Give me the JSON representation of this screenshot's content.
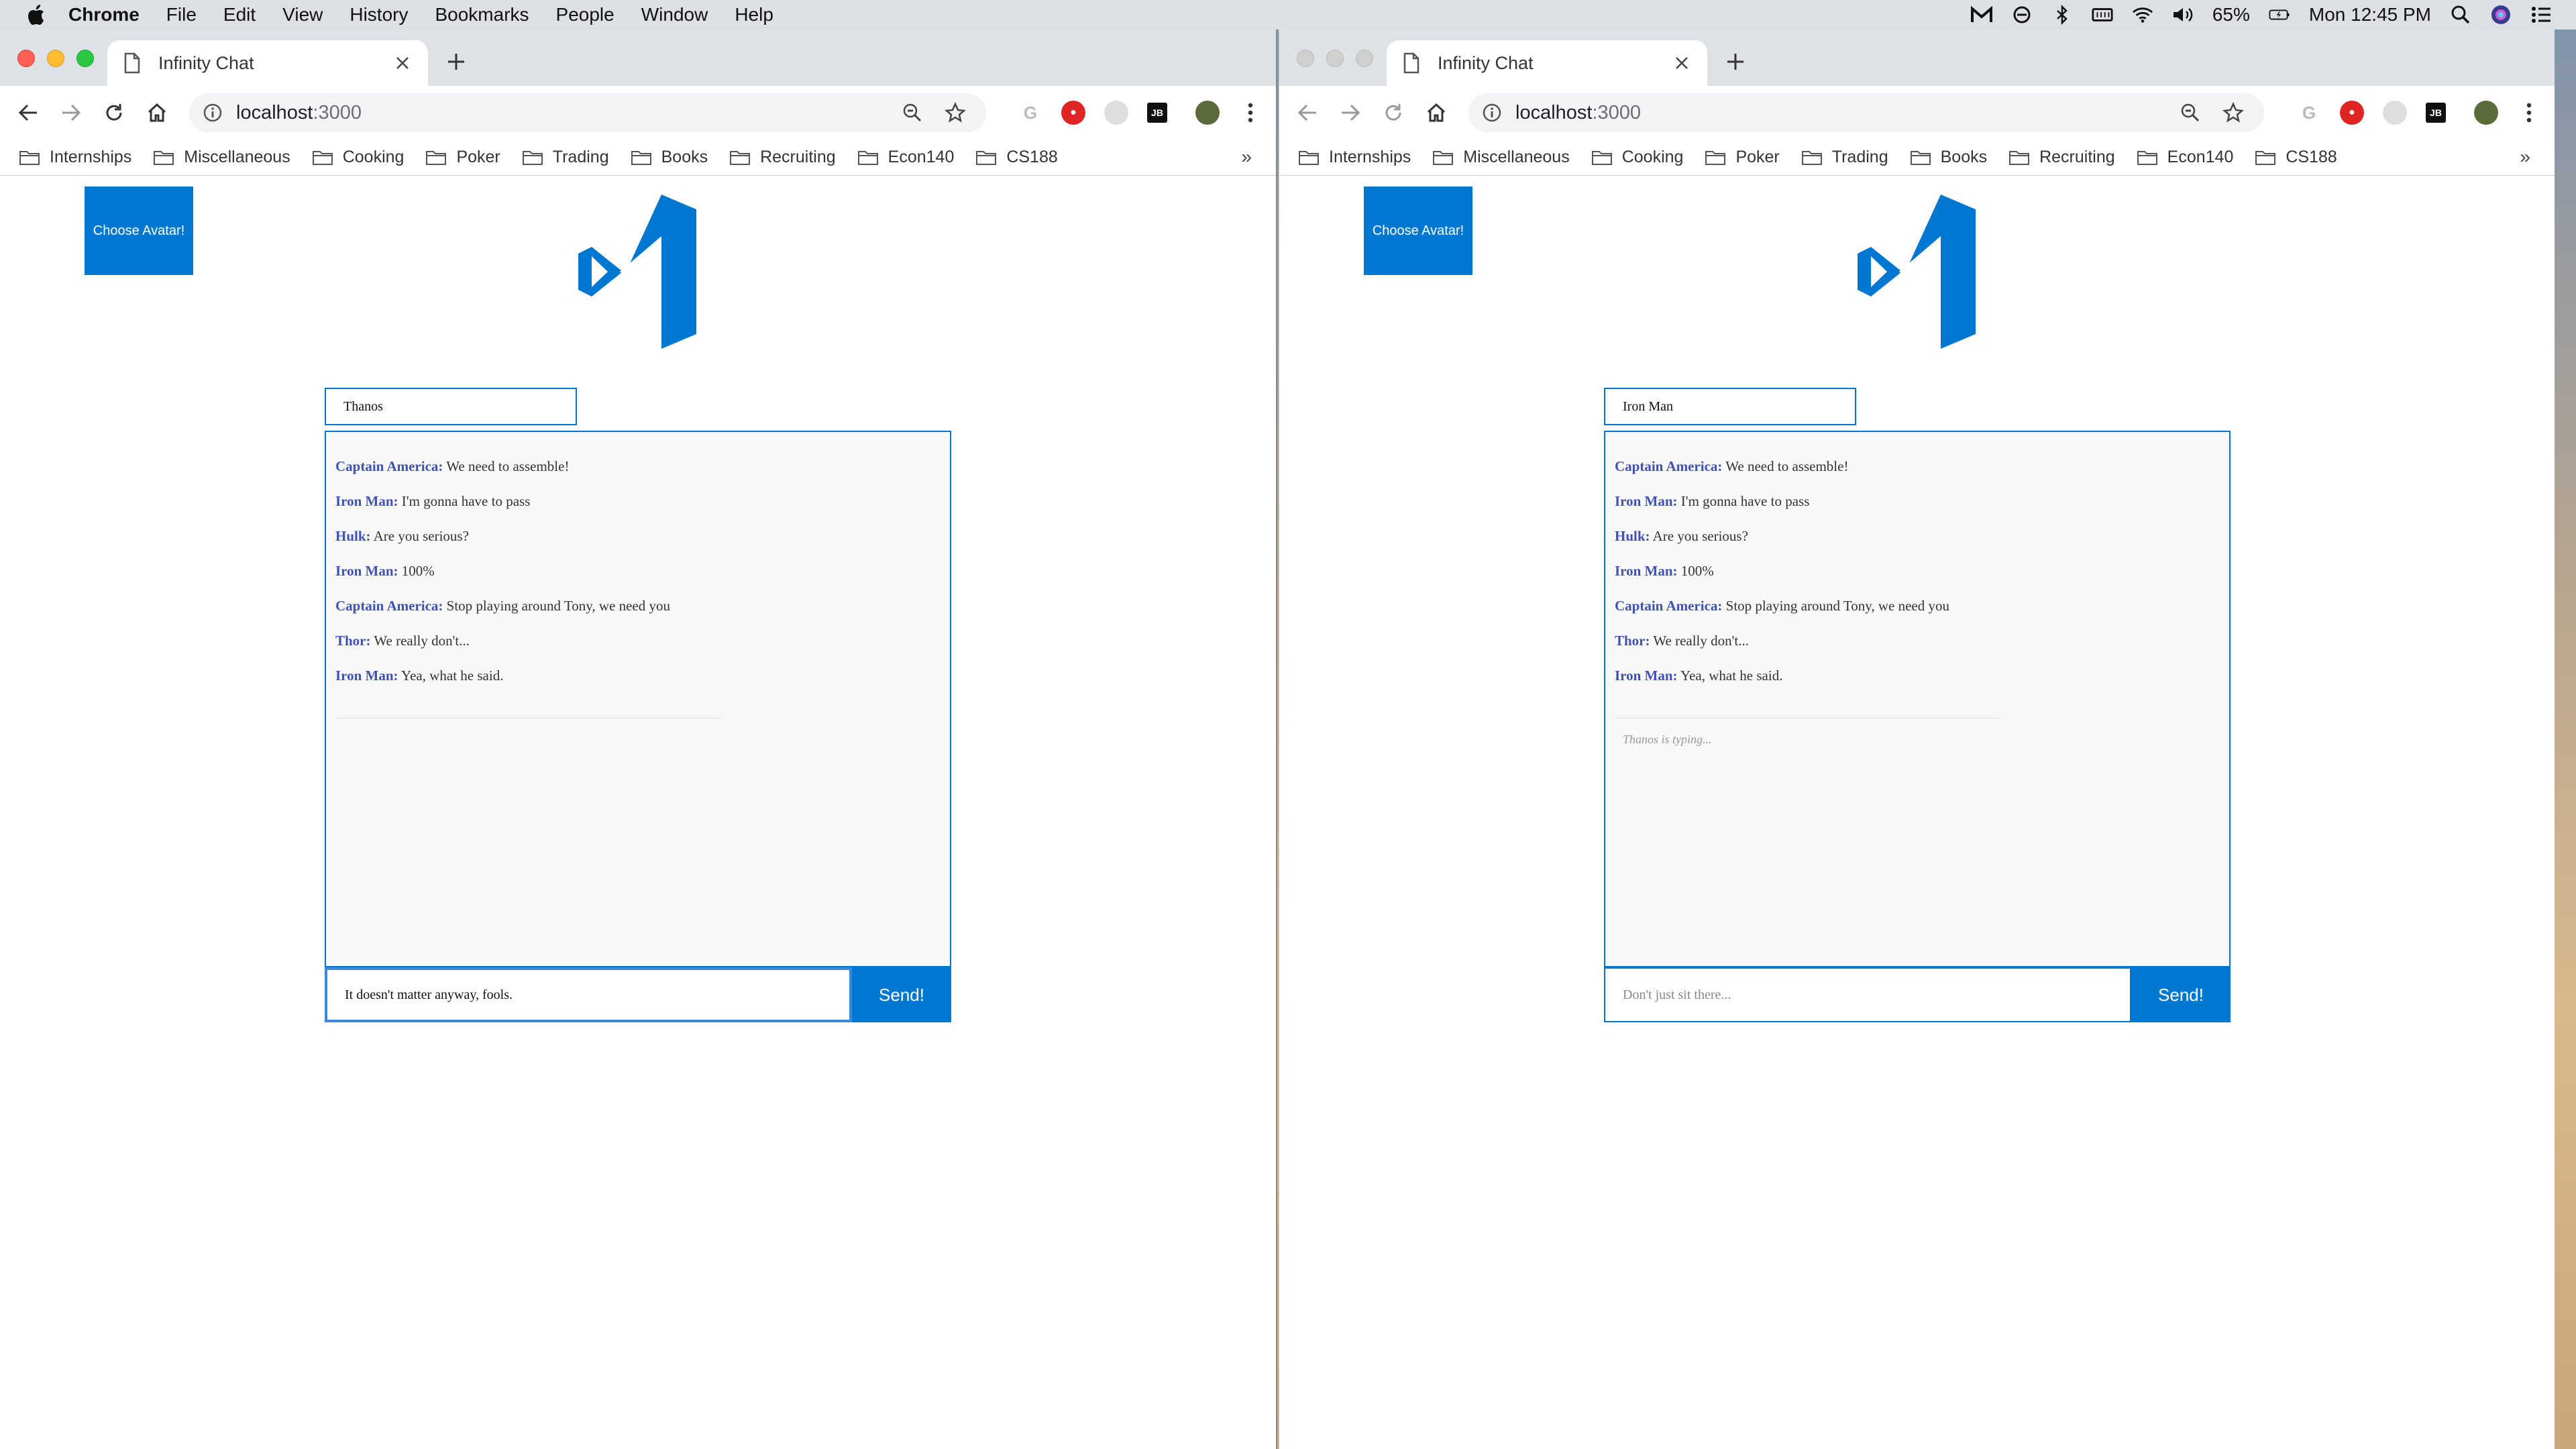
{
  "menubar": {
    "app": "Chrome",
    "items": [
      "File",
      "Edit",
      "View",
      "History",
      "Bookmarks",
      "People",
      "Window",
      "Help"
    ],
    "battery": "65%",
    "clock": "Mon 12:45 PM"
  },
  "windows": [
    {
      "tab_title": "Infinity Chat",
      "url_host": "localhost",
      "url_port": ":3000",
      "bookmarks": [
        "Internships",
        "Miscellaneous",
        "Cooking",
        "Poker",
        "Trading",
        "Books",
        "Recruiting",
        "Econ140",
        "CS188"
      ],
      "bookmarks_more": "»",
      "avatar_button": "Choose Avatar!",
      "username": "Thanos",
      "messages": [
        {
          "sender": "Captain America:",
          "text": " We need to assemble!"
        },
        {
          "sender": "Iron Man:",
          "text": " I'm gonna have to pass"
        },
        {
          "sender": "Hulk:",
          "text": " Are you serious?"
        },
        {
          "sender": "Iron Man:",
          "text": " 100%"
        },
        {
          "sender": "Captain America:",
          "text": " Stop playing around Tony, we need you"
        },
        {
          "sender": "Thor:",
          "text": " We really don't..."
        },
        {
          "sender": "Iron Man:",
          "text": " Yea, what he said."
        }
      ],
      "typing": "",
      "compose_value": "It doesn't matter anyway, fools.",
      "compose_placeholder": "Don't just sit there...",
      "send": "Send!"
    },
    {
      "tab_title": "Infinity Chat",
      "url_host": "localhost",
      "url_port": ":3000",
      "bookmarks": [
        "Internships",
        "Miscellaneous",
        "Cooking",
        "Poker",
        "Trading",
        "Books",
        "Recruiting",
        "Econ140",
        "CS188"
      ],
      "bookmarks_more": "»",
      "avatar_button": "Choose Avatar!",
      "username": "Iron Man",
      "messages": [
        {
          "sender": "Captain America:",
          "text": " We need to assemble!"
        },
        {
          "sender": "Iron Man:",
          "text": " I'm gonna have to pass"
        },
        {
          "sender": "Hulk:",
          "text": " Are you serious?"
        },
        {
          "sender": "Iron Man:",
          "text": " 100%"
        },
        {
          "sender": "Captain America:",
          "text": " Stop playing around Tony, we need you"
        },
        {
          "sender": "Thor:",
          "text": " We really don't..."
        },
        {
          "sender": "Iron Man:",
          "text": " Yea, what he said."
        }
      ],
      "typing": "Thanos is typing...",
      "compose_value": "",
      "compose_placeholder": "Don't just sit there...",
      "send": "Send!"
    }
  ],
  "colors": {
    "accent": "#0078d2",
    "sender": "#3f51b5",
    "chat_bg": "#f8f8f8"
  },
  "icons": [
    "apple-icon",
    "page-icon",
    "close-icon",
    "plus-icon",
    "back-icon",
    "forward-icon",
    "reload-icon",
    "home-icon",
    "info-icon",
    "zoom-icon",
    "star-icon",
    "folder-icon",
    "visual-studio-logo"
  ]
}
